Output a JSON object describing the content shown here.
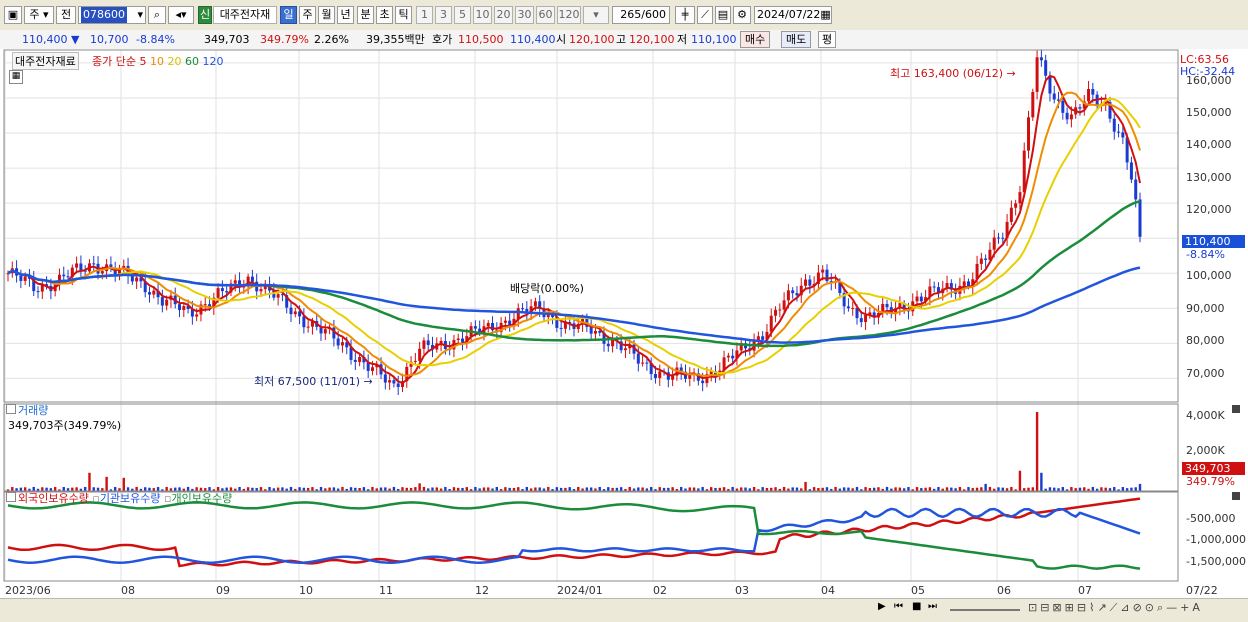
{
  "toolbar": {
    "market": "주",
    "side": "전",
    "code": "078600",
    "credit_badge": "신",
    "stock_name": "대주전자재",
    "periods": [
      "일",
      "주",
      "월",
      "년",
      "분",
      "초",
      "틱"
    ],
    "active_period": "일",
    "intervals": [
      "1",
      "3",
      "5",
      "10",
      "20",
      "30",
      "60",
      "120"
    ],
    "count": "265",
    "count_total": "/600",
    "date": "2024/07/22"
  },
  "quote": {
    "price": "110,400",
    "arrow": "▼",
    "change": "10,700",
    "change_pct": "-8.84%",
    "volume": "349,703",
    "volume_ratio": "349.79%",
    "turnover_pct": "2.26%",
    "amount": "39,355백만",
    "bid_label": "호가",
    "ask": "110,500",
    "bid": "110,400",
    "open_label": "시",
    "open": "120,100",
    "high_label": "고",
    "high": "120,100",
    "low_label": "저",
    "low": "110,100",
    "buy_btn": "매수",
    "sell_btn": "매도",
    "eval_btn": "평"
  },
  "price_panel": {
    "name_tag": "대주전자재료",
    "ma_label": "종가 단순",
    "ma_periods": [
      "5",
      "10",
      "20",
      "60",
      "120"
    ],
    "ma_colors": [
      "#d01010",
      "#f08c00",
      "#e8d000",
      "#1a8c3a",
      "#2255dd"
    ],
    "lc": "LC:63.56",
    "hc": "HC:-32.44",
    "max_note": "최고 163,400 (06/12)",
    "min_note": "최저 67,500 (11/01)",
    "dividend_note": "배당락(0.00%)",
    "current_tag": "110,400",
    "current_pct": "-8.84%",
    "y_ticks": [
      "160,000",
      "150,000",
      "140,000",
      "130,000",
      "120,000",
      "110,000",
      "100,000",
      "90,000",
      "80,000",
      "70,000"
    ]
  },
  "volume_panel": {
    "title": "거래량",
    "value_label": "349,703주(349.79%)",
    "y_ticks": [
      "4,000K",
      "2,000K"
    ],
    "current_tag": "349,703",
    "current_pct": "349.79%"
  },
  "holding_panel": {
    "legend": [
      "외국인보유수량",
      "기관보유수량",
      "개인보유수량"
    ],
    "legend_colors": [
      "#d01010",
      "#2255dd",
      "#1a8c3a"
    ],
    "y_ticks": [
      "-500,000",
      "-1,000,000",
      "-1,500,000"
    ]
  },
  "x_axis": {
    "labels": [
      "2023/06",
      "08",
      "09",
      "10",
      "11",
      "12",
      "2024/01",
      "02",
      "03",
      "04",
      "05",
      "06",
      "07"
    ],
    "right_label": "07/22"
  },
  "chart_data": {
    "type": "line",
    "title": "대주전자재료",
    "series": [
      {
        "name": "5",
        "values": []
      },
      {
        "name": "10",
        "values": []
      },
      {
        "name": "20",
        "values": []
      },
      {
        "name": "60",
        "values": []
      },
      {
        "name": "120",
        "values": []
      }
    ],
    "price_range": [
      63560,
      163400
    ],
    "x": [
      "2023/06",
      "08",
      "09",
      "10",
      "11",
      "12",
      "2024/01",
      "02",
      "03",
      "04",
      "05",
      "06",
      "07"
    ],
    "volume_range_k": [
      0,
      4000
    ]
  }
}
